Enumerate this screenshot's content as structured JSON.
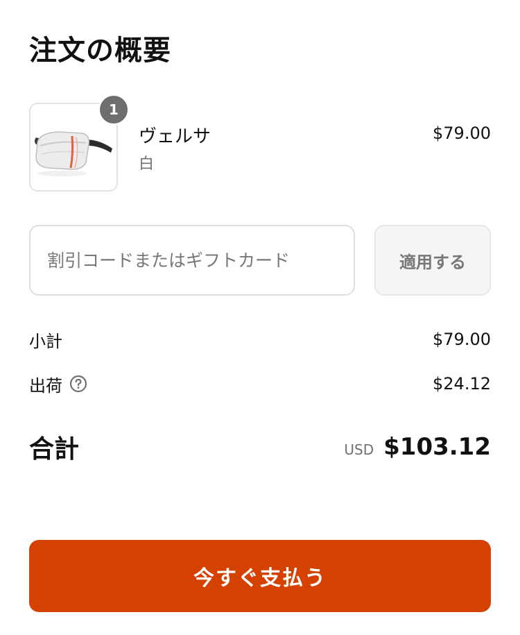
{
  "summary": {
    "title": "注文の概要"
  },
  "item": {
    "quantity": "1",
    "name": "ヴェルサ",
    "variant": "白",
    "price": "$79.00",
    "image_icon": "waist-bag-image"
  },
  "discount": {
    "placeholder": "割引コードまたはギフトカード",
    "value": "",
    "apply_label": "適用する"
  },
  "totals": {
    "subtotal_label": "小計",
    "subtotal_value": "$79.00",
    "shipping_label": "出荷",
    "shipping_value": "$24.12",
    "shipping_help_icon": "question-circle-icon",
    "total_label": "合計",
    "currency": "USD",
    "total_value": "$103.12"
  },
  "pay": {
    "label": "今すぐ支払う"
  },
  "colors": {
    "accent": "#d44100",
    "badge": "#6e6e6e",
    "muted_text": "#707070",
    "border": "#dedede"
  }
}
